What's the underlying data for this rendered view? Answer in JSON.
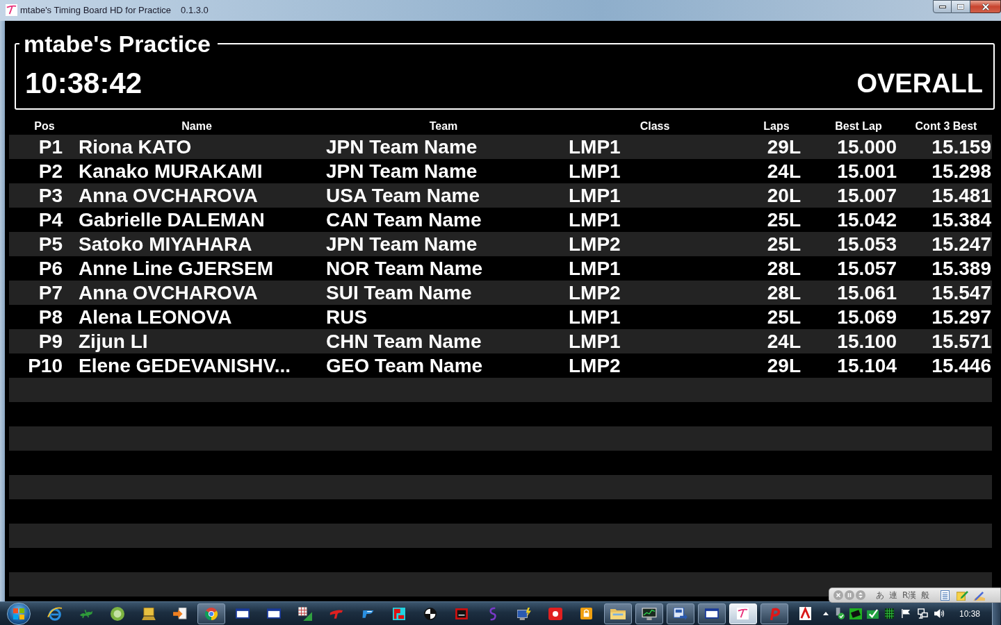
{
  "window": {
    "title": "mtabe's Timing Board HD for Practice",
    "version": "0.1.3.0"
  },
  "board": {
    "session": "mtabe's Practice",
    "clock": "10:38:42",
    "category": "OVERALL"
  },
  "table": {
    "columns": [
      "Pos",
      "Name",
      "Team",
      "Class",
      "Laps",
      "Best Lap",
      "Cont 3 Best"
    ],
    "rows": [
      [
        "P1",
        "Riona KATO",
        "JPN Team Name",
        "LMP1",
        "29L",
        "15.000",
        "15.159"
      ],
      [
        "P2",
        "Kanako MURAKAMI",
        "JPN Team Name",
        "LMP1",
        "24L",
        "15.001",
        "15.298"
      ],
      [
        "P3",
        "Anna OVCHAROVA",
        "USA Team Name",
        "LMP1",
        "20L",
        "15.007",
        "15.481"
      ],
      [
        "P4",
        "Gabrielle DALEMAN",
        "CAN Team Name",
        "LMP1",
        "25L",
        "15.042",
        "15.384"
      ],
      [
        "P5",
        "Satoko MIYAHARA",
        "JPN Team Name",
        "LMP2",
        "25L",
        "15.053",
        "15.247"
      ],
      [
        "P6",
        "Anne Line GJERSEM",
        "NOR Team Name",
        "LMP1",
        "28L",
        "15.057",
        "15.389"
      ],
      [
        "P7",
        "Anna OVCHAROVA",
        "SUI Team Name",
        "LMP2",
        "28L",
        "15.061",
        "15.547"
      ],
      [
        "P8",
        "Alena LEONOVA",
        "RUS",
        "LMP1",
        "25L",
        "15.069",
        "15.297"
      ],
      [
        "P9",
        "Zijun LI",
        "CHN Team Name",
        "LMP1",
        "24L",
        "15.100",
        "15.571"
      ],
      [
        "P10",
        "Elene GEDEVANISHV...",
        "GEO Team Name",
        "LMP2",
        "29L",
        "15.104",
        "15.446"
      ]
    ]
  },
  "ime_bar": {
    "labels": [
      "あ",
      "連",
      "R漢",
      "般"
    ]
  },
  "taskbar": {
    "items": [
      {
        "kind": "globe",
        "running": false,
        "active": false
      },
      {
        "kind": "lizard",
        "running": false,
        "active": false
      },
      {
        "kind": "disc",
        "running": false,
        "active": false
      },
      {
        "kind": "laptop",
        "running": false,
        "active": false
      },
      {
        "kind": "arrow",
        "running": false,
        "active": false
      },
      {
        "kind": "ball",
        "running": true,
        "active": false
      },
      {
        "kind": "window",
        "running": false,
        "active": false
      },
      {
        "kind": "window",
        "running": false,
        "active": false
      },
      {
        "kind": "chart",
        "running": false,
        "active": false
      },
      {
        "kind": "swoosh",
        "running": false,
        "active": false
      },
      {
        "kind": "wing",
        "running": false,
        "active": false
      },
      {
        "kind": "tile",
        "running": false,
        "active": false
      },
      {
        "kind": "target",
        "running": false,
        "active": false
      },
      {
        "kind": "frame",
        "running": false,
        "active": false
      },
      {
        "kind": "ribbon",
        "running": false,
        "active": false
      },
      {
        "kind": "computer",
        "running": false,
        "active": false
      },
      {
        "kind": "square",
        "running": false,
        "active": false
      },
      {
        "kind": "lock",
        "running": false,
        "active": false
      },
      {
        "kind": "folder",
        "running": true,
        "active": false
      },
      {
        "kind": "monitor",
        "running": true,
        "active": false
      },
      {
        "kind": "document",
        "running": true,
        "active": false
      },
      {
        "kind": "window",
        "running": true,
        "active": false
      },
      {
        "kind": "logo",
        "running": true,
        "active": true
      },
      {
        "kind": "hook",
        "running": true,
        "active": false
      },
      {
        "kind": "page",
        "running": false,
        "active": false
      }
    ],
    "clock": "10:38"
  }
}
